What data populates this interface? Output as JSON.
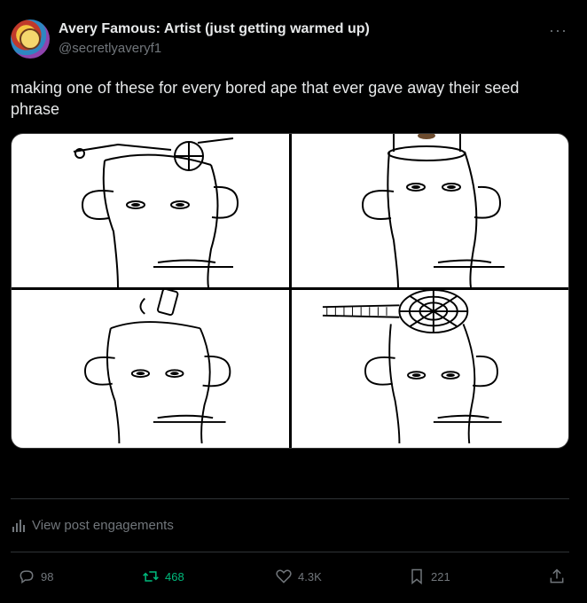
{
  "author": {
    "name": "Avery Famous: Artist (just getting warmed up)",
    "handle": "@secretlyaveryf1"
  },
  "more_label": "···",
  "post": {
    "text": "making one of these for every bored ape that ever gave away their seed phrase"
  },
  "media": {
    "panels": 4
  },
  "engagements_label": "View post engagements",
  "actions": {
    "replies": "98",
    "reposts": "468",
    "likes": "4.3K",
    "bookmarks": "221"
  },
  "colors": {
    "background": "#000000",
    "text": "#e7e9ea",
    "muted": "#71767b",
    "repost_active": "#00ba7c"
  }
}
